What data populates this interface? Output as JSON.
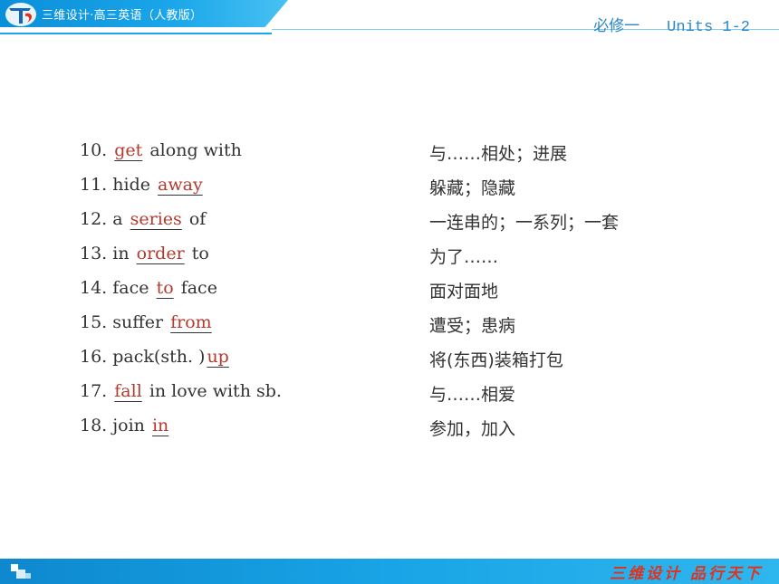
{
  "header": {
    "title": "三维设计·高三英语（人教版）",
    "book": "必修一",
    "units": "Units  1-2"
  },
  "rows": [
    {
      "num": "10.",
      "pre": "",
      "answer": "get",
      "post": "along with",
      "cn": "与……相处；进展"
    },
    {
      "num": "11.",
      "pre": "hide",
      "answer": "away",
      "post": "",
      "cn": "躲藏；隐藏"
    },
    {
      "num": "12.",
      "pre": "a",
      "answer": "series",
      "post": "of",
      "cn": "一连串的；一系列；一套"
    },
    {
      "num": "13.",
      "pre": "in",
      "answer": "order",
      "post": "to",
      "cn": "为了……"
    },
    {
      "num": "14.",
      "pre": "face",
      "answer": "to",
      "post": "face",
      "cn": "面对面地"
    },
    {
      "num": "15.",
      "pre": "suffer",
      "answer": "from",
      "post": "",
      "cn": "遭受；患病"
    },
    {
      "num": "16.",
      "pre": "pack(sth. )",
      "answer": "up",
      "post": "",
      "cn": "将(东西)装箱打包"
    },
    {
      "num": "17.",
      "pre": "",
      "answer": "fall",
      "post": "in love with sb.",
      "cn": "与……相爱"
    },
    {
      "num": "18.",
      "pre": "join",
      "answer": "in",
      "post": "",
      "cn": "参加，加入"
    }
  ],
  "footer": {
    "slogan": "三维设计  品行天下"
  },
  "colors": {
    "accent": "#1aa6ea",
    "answer": "#b23a2e",
    "slogan": "#e0321e"
  }
}
